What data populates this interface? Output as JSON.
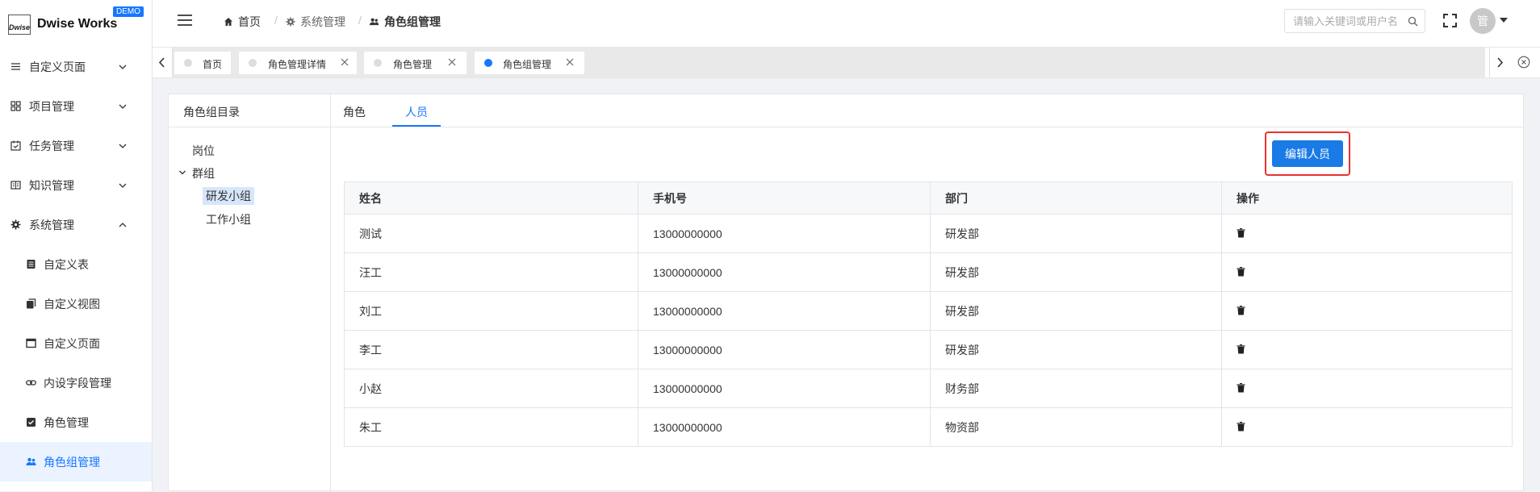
{
  "brand": {
    "logo_mark": "Dwise",
    "name": "Dwise Works",
    "badge": "DEMO"
  },
  "sidebar": {
    "items": [
      {
        "label": "自定义页面",
        "icon": "list-icon",
        "chevron": "down",
        "level": 1
      },
      {
        "label": "项目管理",
        "icon": "grid-icon",
        "chevron": "down",
        "level": 1
      },
      {
        "label": "任务管理",
        "icon": "calendar-check-icon",
        "chevron": "down",
        "level": 1
      },
      {
        "label": "知识管理",
        "icon": "book-icon",
        "chevron": "down",
        "level": 1
      },
      {
        "label": "系统管理",
        "icon": "gear-icon",
        "chevron": "up",
        "level": 1
      },
      {
        "label": "自定义表",
        "icon": "table-icon",
        "level": 2
      },
      {
        "label": "自定义视图",
        "icon": "copy-icon",
        "level": 2
      },
      {
        "label": "自定义页面",
        "icon": "window-icon",
        "level": 2
      },
      {
        "label": "内设字段管理",
        "icon": "link-icon",
        "level": 2
      },
      {
        "label": "角色管理",
        "icon": "checkbox-icon",
        "level": 2
      },
      {
        "label": "角色组管理",
        "icon": "users-icon",
        "level": 2,
        "active": true
      }
    ]
  },
  "header": {
    "breadcrumb": [
      {
        "label": "首页",
        "icon": "home-icon"
      },
      {
        "label": "系统管理",
        "icon": "gear-icon"
      },
      {
        "label": "角色组管理",
        "icon": "users-icon"
      }
    ],
    "breadcrumb_separator": "/",
    "search_placeholder": "请输入关键词或用户名",
    "avatar_text": "管"
  },
  "tabs": [
    {
      "label": "首页",
      "closable": false,
      "active": false
    },
    {
      "label": "角色管理详情",
      "closable": true,
      "active": false
    },
    {
      "label": "角色管理",
      "closable": true,
      "active": false
    },
    {
      "label": "角色组管理",
      "closable": true,
      "active": true
    }
  ],
  "tree": {
    "title": "角色组目录",
    "nodes": [
      {
        "label": "岗位"
      },
      {
        "label": "群组",
        "expanded": true
      },
      {
        "label": "研发小组",
        "selected": true
      },
      {
        "label": "工作小组"
      }
    ]
  },
  "panel_tabs": [
    {
      "label": "角色",
      "active": false
    },
    {
      "label": "人员",
      "active": true
    }
  ],
  "edit_button_label": "编辑人员",
  "table": {
    "columns": [
      "姓名",
      "手机号",
      "部门",
      "操作"
    ],
    "rows": [
      {
        "name": "测试",
        "phone": "13000000000",
        "dept": "研发部"
      },
      {
        "name": "汪工",
        "phone": "13000000000",
        "dept": "研发部"
      },
      {
        "name": "刘工",
        "phone": "13000000000",
        "dept": "研发部"
      },
      {
        "name": "李工",
        "phone": "13000000000",
        "dept": "研发部"
      },
      {
        "name": "小赵",
        "phone": "13000000000",
        "dept": "财务部"
      },
      {
        "name": "朱工",
        "phone": "13000000000",
        "dept": "物资部"
      }
    ]
  },
  "colors": {
    "accent": "#1677ff",
    "button": "#1a7ae6",
    "highlight_border": "#e8332d",
    "active_menu_bg": "#eaf3ff"
  }
}
